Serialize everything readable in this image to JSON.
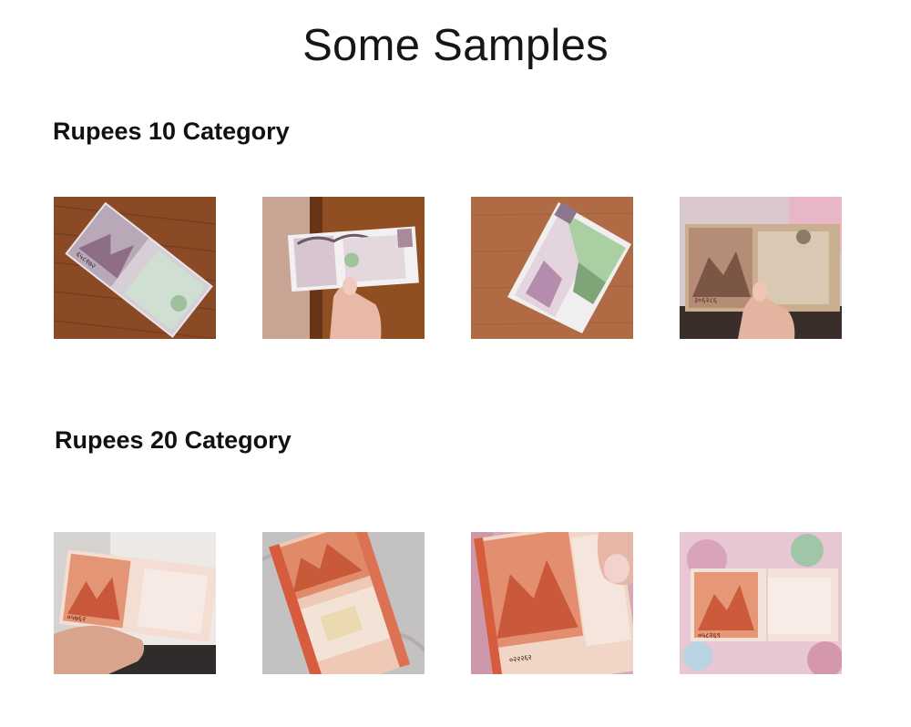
{
  "page": {
    "title": "Some Samples"
  },
  "sections": [
    {
      "heading": "Rupees 10 Category",
      "samples": [
        {
          "serial": "६५८१७२",
          "alt": "photo of a Rs 10 banknote on a wooden table"
        },
        {
          "serial": "",
          "alt": "photo of a hand holding a Rs 10 banknote"
        },
        {
          "serial": "",
          "alt": "photo of a folded Rs 10 banknote on a wooden floor"
        },
        {
          "serial": "३०६२८६",
          "alt": "photo of a hand holding a Rs 10 banknote over a cloth"
        }
      ]
    },
    {
      "heading": "Rupees 20 Category",
      "samples": [
        {
          "serial": "०५७६२",
          "alt": "photo of a hand holding a Rs 20 banknote"
        },
        {
          "serial": "",
          "alt": "photo of a Rs 20 banknote on a grey cloth"
        },
        {
          "serial": "०२२२६२",
          "alt": "close-up photo of a Rs 20 banknote held between fingers"
        },
        {
          "serial": "०५८२६९",
          "alt": "photo of a Rs 20 banknote on a pink floral cloth"
        }
      ]
    }
  ],
  "colors": {
    "rs10_note": "#c9bcc6",
    "rs10_green": "#8fb48a",
    "rs20_note": "#e59a7d",
    "rs20_border": "#d35a38",
    "wood": "#9a5a32"
  }
}
